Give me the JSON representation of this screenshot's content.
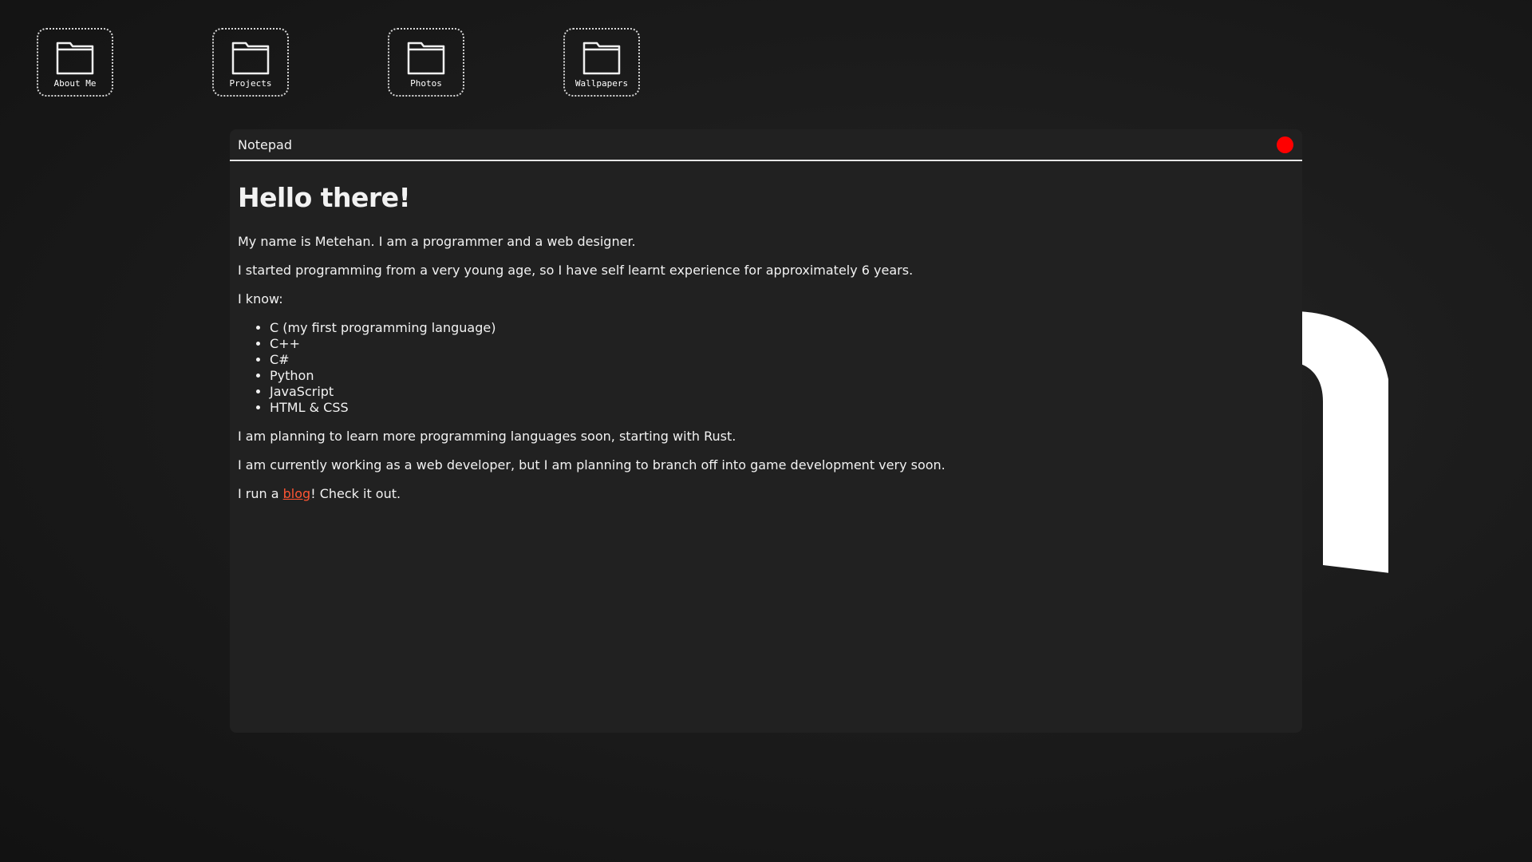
{
  "desktop": {
    "icons": [
      {
        "label": "About Me",
        "icon": "folder-icon"
      },
      {
        "label": "Projects",
        "icon": "folder-icon"
      },
      {
        "label": "Photos",
        "icon": "folder-icon"
      },
      {
        "label": "Wallpapers",
        "icon": "folder-icon"
      }
    ]
  },
  "window": {
    "title": "Notepad",
    "close_color": "#ff0000"
  },
  "content": {
    "heading": "Hello there!",
    "paragraphs": [
      "My name is Metehan. I am a programmer and a web designer.",
      "I started programming from a very young age, so I have self learnt experience for approximately 6 years.",
      "I know:"
    ],
    "languages": [
      "C (my first programming language)",
      "C++",
      "C#",
      "Python",
      "JavaScript",
      "HTML & CSS"
    ],
    "after_list": [
      "I am planning to learn more programming languages soon, starting with Rust.",
      "I am currently working as a web developer, but I am planning to branch off into game development very soon."
    ],
    "blog_line": {
      "prefix": "I run a ",
      "link_text": "blog",
      "suffix": "! Check it out."
    }
  },
  "colors": {
    "background": "#1c1c1c",
    "window_bg": "#212121",
    "link": "#ff5533",
    "text": "#f2f2f2"
  }
}
